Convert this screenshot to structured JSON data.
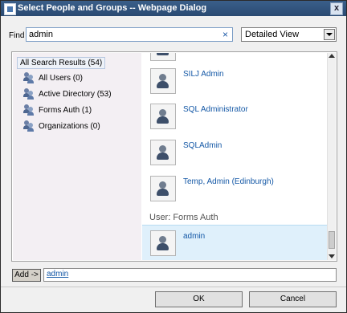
{
  "window": {
    "title": "Select People and Groups -- Webpage Dialog",
    "close_glyph": "x",
    "icon": "dialog-icon"
  },
  "find": {
    "label": "Find",
    "value": "admin",
    "clear_glyph": "×"
  },
  "view_select": {
    "value": "Detailed View",
    "icon": "dropdown-arrow-icon"
  },
  "tree": {
    "root": "All Search Results (54)",
    "items": [
      {
        "label": "All Users (0)",
        "icon": "group-icon"
      },
      {
        "label": "Active Directory (53)",
        "icon": "group-icon"
      },
      {
        "label": "Forms Auth (1)",
        "icon": "group-icon"
      },
      {
        "label": "Organizations (0)",
        "icon": "group-icon"
      }
    ]
  },
  "results": {
    "entries": [
      {
        "name": "SILJ Admin",
        "icon": "user-picture-icon"
      },
      {
        "name": "SQL Administrator",
        "icon": "user-picture-icon"
      },
      {
        "name": "SQLAdmin",
        "icon": "user-picture-icon"
      },
      {
        "name": "Temp, Admin (Edinburgh)",
        "icon": "user-picture-icon"
      }
    ],
    "group_header": "User: Forms Auth",
    "selected": {
      "name": "admin",
      "icon": "user-picture-icon"
    }
  },
  "add": {
    "button_label": "Add ->",
    "value": "admin"
  },
  "buttons": {
    "ok": "OK",
    "cancel": "Cancel"
  }
}
